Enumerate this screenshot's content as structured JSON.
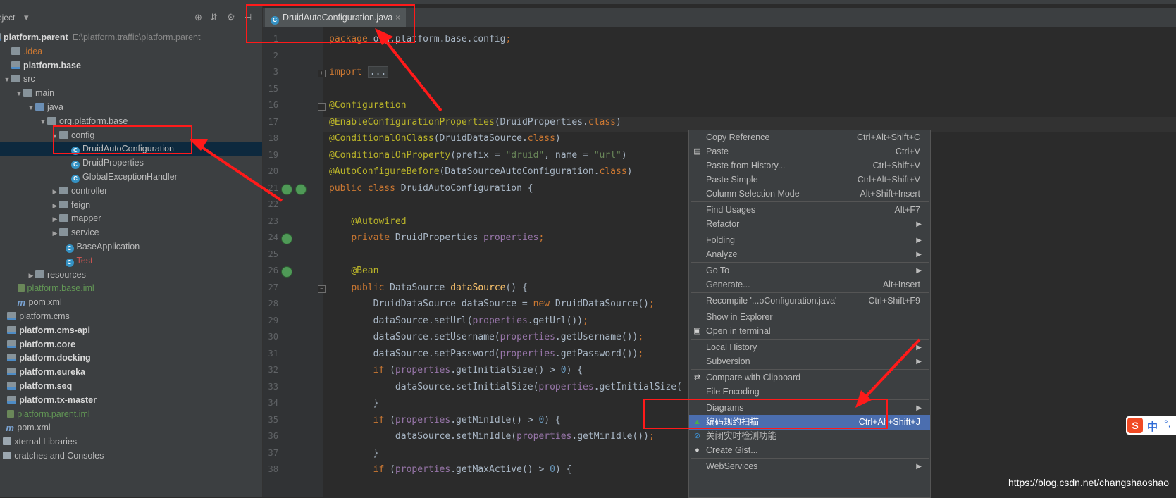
{
  "project_panel": {
    "title": "oject",
    "tree": [
      {
        "label": "platform.parent",
        "path": "E:\\platform.traffic\\platform.parent",
        "bold": true,
        "icon": "module",
        "indent": -4
      },
      {
        "label": ".idea",
        "color": "orange",
        "icon": "folder",
        "indent": 0
      },
      {
        "label": "platform.base",
        "bold": true,
        "icon": "module",
        "indent": 0
      },
      {
        "label": "src",
        "icon": "folder",
        "indent": 0,
        "arrow": "down"
      },
      {
        "label": "main",
        "icon": "folder",
        "indent": 1,
        "arrow": "down"
      },
      {
        "label": "java",
        "icon": "folder-src",
        "indent": 2,
        "arrow": "down"
      },
      {
        "label": "org.platform.base",
        "icon": "folder",
        "indent": 3,
        "arrow": "down"
      },
      {
        "label": "config",
        "icon": "folder",
        "indent": 4,
        "arrow": "down"
      },
      {
        "label": "DruidAutoConfiguration",
        "icon": "class",
        "indent": 5,
        "selected": true
      },
      {
        "label": "DruidProperties",
        "icon": "class",
        "indent": 5
      },
      {
        "label": "GlobalExceptionHandler",
        "icon": "class",
        "indent": 5
      },
      {
        "label": "controller",
        "icon": "folder",
        "indent": 4,
        "arrow": "right"
      },
      {
        "label": "feign",
        "icon": "folder",
        "indent": 4,
        "arrow": "right"
      },
      {
        "label": "mapper",
        "icon": "folder",
        "indent": 4,
        "arrow": "right"
      },
      {
        "label": "service",
        "icon": "folder",
        "indent": 4,
        "arrow": "right"
      },
      {
        "label": "BaseApplication",
        "icon": "class",
        "indent": 4.5
      },
      {
        "label": "Test",
        "icon": "class",
        "indent": 4.5,
        "color": "red"
      },
      {
        "label": "resources",
        "icon": "folder",
        "indent": 2,
        "arrow": "right"
      },
      {
        "label": "platform.base.iml",
        "icon": "iml",
        "indent": 0.5,
        "color": "green"
      },
      {
        "label": "pom.xml",
        "icon": "maven",
        "indent": 0.5
      },
      {
        "label": "platform.cms",
        "icon": "module",
        "indent": -0.3
      },
      {
        "label": "platform.cms-api",
        "bold": true,
        "icon": "module",
        "indent": -0.3
      },
      {
        "label": "platform.core",
        "bold": true,
        "icon": "module",
        "indent": -0.3
      },
      {
        "label": "platform.docking",
        "bold": true,
        "icon": "module",
        "indent": -0.3
      },
      {
        "label": "platform.eureka",
        "bold": true,
        "icon": "module",
        "indent": -0.3
      },
      {
        "label": "platform.seq",
        "bold": true,
        "icon": "module",
        "indent": -0.3
      },
      {
        "label": "platform.tx-master",
        "bold": true,
        "icon": "module",
        "indent": -0.3
      },
      {
        "label": "platform.parent.iml",
        "icon": "iml",
        "indent": -0.3,
        "color": "green"
      },
      {
        "label": "pom.xml",
        "icon": "maven",
        "indent": -0.6
      },
      {
        "label": "xternal Libraries",
        "icon": "lib",
        "indent": -1.3
      },
      {
        "label": "cratches and Consoles",
        "icon": "lib",
        "indent": -1.3
      }
    ]
  },
  "editor": {
    "tab_label": "DruidAutoConfiguration.java",
    "tab_close": "×",
    "line_numbers": [
      "1",
      "2",
      "3",
      "15",
      "16",
      "17",
      "18",
      "19",
      "20",
      "21",
      "22",
      "23",
      "24",
      "25",
      "26",
      "27",
      "28",
      "29",
      "30",
      "31",
      "32",
      "33",
      "34",
      "35",
      "36",
      "37",
      "38"
    ],
    "lines": [
      "<span class='k'>package</span> org.platform.base.config<span class='k'>;</span>",
      "",
      "<span class='k'>import</span> <span class='foldbox'>...</span>",
      "",
      "<span class='a'>@Configuration</span>",
      "<span class='a'>@EnableConfigurationProperties</span>(DruidProperties.<span class='k'>class</span>)",
      "<span class='a'>@ConditionalOnClass</span>(DruidDataSource.<span class='k'>class</span>)",
      "<span class='a'>@ConditionalOnProperty</span>(prefix = <span class='s'>\"druid\"</span>, name = <span class='s'>\"url\"</span>)",
      "<span class='a'>@AutoConfigureBefore</span>(DataSourceAutoConfiguration.<span class='k'>class</span>)",
      "<span class='k'>public class</span> <span class='u'>DruidAutoConfiguration</span> {",
      "",
      "    <span class='a'>@Autowired</span>",
      "    <span class='k'>private</span> DruidProperties <span class='f'>properties</span><span class='k'>;</span>",
      "",
      "    <span class='a'>@Bean</span>",
      "    <span class='k'>public</span> DataSource <span class='m'>dataSource</span>() {",
      "        DruidDataSource dataSource = <span class='k'>new</span> DruidDataSource()<span class='k'>;</span>",
      "        dataSource.setUrl(<span class='f'>properties</span>.getUrl())<span class='k'>;</span>",
      "        dataSource.setUsername(<span class='f'>properties</span>.getUsername())<span class='k'>;</span>",
      "        dataSource.setPassword(<span class='f'>properties</span>.getPassword())<span class='k'>;</span>",
      "        <span class='k'>if</span> (<span class='f'>properties</span>.getInitialSize() > <span class='n'>0</span>) {",
      "            dataSource.setInitialSize(<span class='f'>properties</span>.getInitialSize(",
      "        }",
      "        <span class='k'>if</span> (<span class='f'>properties</span>.getMinIdle() > <span class='n'>0</span>) {",
      "            dataSource.setMinIdle(<span class='f'>properties</span>.getMinIdle())<span class='k'>;</span>",
      "        }",
      "        <span class='k'>if</span> (<span class='f'>properties</span>.getMaxActive() > <span class='n'>0</span>) {"
    ]
  },
  "context_menu": [
    {
      "label": "Copy Reference",
      "key": "Ctrl+Alt+Shift+C"
    },
    {
      "label": "Paste",
      "key": "Ctrl+V",
      "icon": "paste-icon"
    },
    {
      "label": "Paste from History...",
      "key": "Ctrl+Shift+V"
    },
    {
      "label": "Paste Simple",
      "key": "Ctrl+Alt+Shift+V"
    },
    {
      "label": "Column Selection Mode",
      "key": "Alt+Shift+Insert"
    },
    {
      "sep": true
    },
    {
      "label": "Find Usages",
      "key": "Alt+F7"
    },
    {
      "label": "Refactor",
      "submenu": true
    },
    {
      "sep": true
    },
    {
      "label": "Folding",
      "submenu": true
    },
    {
      "label": "Analyze",
      "submenu": true
    },
    {
      "sep": true
    },
    {
      "label": "Go To",
      "submenu": true
    },
    {
      "label": "Generate...",
      "key": "Alt+Insert"
    },
    {
      "sep": true
    },
    {
      "label": "Recompile '...oConfiguration.java'",
      "key": "Ctrl+Shift+F9"
    },
    {
      "sep": true
    },
    {
      "label": "Show in Explorer"
    },
    {
      "label": "Open in terminal",
      "icon": "terminal-icon"
    },
    {
      "sep": true
    },
    {
      "label": "Local History",
      "submenu": true
    },
    {
      "label": "Subversion",
      "submenu": true
    },
    {
      "sep": true
    },
    {
      "label": "Compare with Clipboard",
      "icon": "compare-icon"
    },
    {
      "label": "File Encoding"
    },
    {
      "sep": true
    },
    {
      "label": "Diagrams",
      "submenu": true
    },
    {
      "label": "编码规约扫描",
      "key": "Ctrl+Alt+Shift+J",
      "highlighted": true,
      "icon": "scan-icon"
    },
    {
      "label": "关闭实时检测功能",
      "icon": "realtime-icon"
    },
    {
      "label": "Create Gist...",
      "icon": "github-icon"
    },
    {
      "sep": true
    },
    {
      "label": "WebServices",
      "submenu": true
    }
  ],
  "watermark": "https://blog.csdn.net/changshaoshao",
  "ime": {
    "logo": "S",
    "text": "中",
    "dot": "°,"
  },
  "colors": {
    "annotation": "#ff1a1a",
    "menu_highlight": "#4b6eaf",
    "selection": "#0d293e"
  }
}
